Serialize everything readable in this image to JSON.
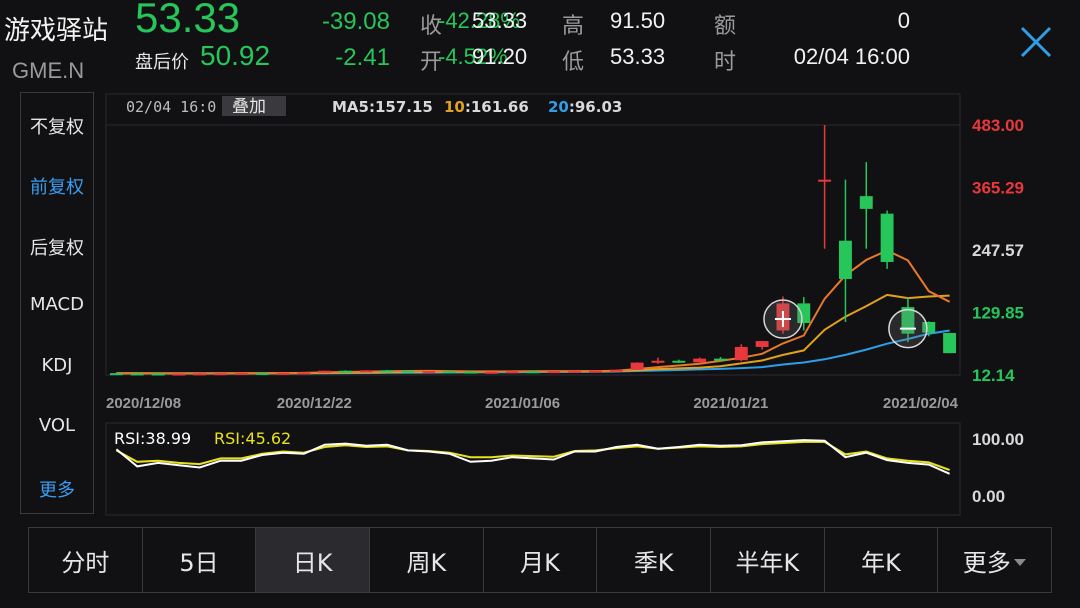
{
  "stock": {
    "name": "游戏驿站",
    "code": "GME.N",
    "price": "53.33",
    "change": "-39.08",
    "after_hours_label": "盘后价",
    "after_hours_price": "50.92",
    "after_hours_change": "-2.41",
    "change_pct_ghost": "-42.28%",
    "after_pct_ghost": "-4.52%"
  },
  "quote": {
    "close_label": "收",
    "close_value": "53.33",
    "high_label": "高",
    "high_value": "91.50",
    "amount_label": "额",
    "amount_value": "0",
    "open_label": "开",
    "open_value": "91.20",
    "low_label": "低",
    "low_value": "53.33",
    "time_label": "时",
    "time_value": "02/04 16:00"
  },
  "left_menu": [
    {
      "label": "不复权",
      "active": false
    },
    {
      "label": "前复权",
      "active": true
    },
    {
      "label": "后复权",
      "active": false
    },
    {
      "label": "MACD",
      "active": false
    },
    {
      "label": "KDJ",
      "active": false
    },
    {
      "label": "VOL",
      "active": false
    },
    {
      "label": "更多",
      "active": true
    }
  ],
  "tabs": [
    {
      "label": "分时",
      "active": false
    },
    {
      "label": "5日",
      "active": false
    },
    {
      "label": "日K",
      "active": true
    },
    {
      "label": "周K",
      "active": false
    },
    {
      "label": "月K",
      "active": false
    },
    {
      "label": "季K",
      "active": false
    },
    {
      "label": "半年K",
      "active": false
    },
    {
      "label": "年K",
      "active": false
    },
    {
      "label": "更多",
      "active": false,
      "dropdown": true
    }
  ],
  "colors": {
    "up": "#e8383d",
    "down": "#26c65a",
    "ma5": "#e8792a",
    "ma10": "#e0a21e",
    "ma20": "#2f9ee8",
    "rsi1": "#ffffff",
    "rsi2": "#e8e21e",
    "accent": "#3a9df2"
  },
  "chart_data": {
    "type": "candlestick",
    "date_label": "02/04 16:0",
    "overlay_button": "叠加",
    "ma_legend": [
      {
        "key": "MA5",
        "value": ":157.15",
        "color": "#e8792a"
      },
      {
        "key": "10",
        "value": ":161.66",
        "color": "#e0a21e"
      },
      {
        "key": "20",
        "value": ":96.03",
        "color": "#2f9ee8"
      }
    ],
    "y_ticks": [
      {
        "value": 483.0,
        "label": "483.00",
        "color": "#e8383d"
      },
      {
        "value": 365.29,
        "label": "365.29",
        "color": "#e8383d"
      },
      {
        "value": 247.57,
        "label": "247.57",
        "color": "#d8d8d8"
      },
      {
        "value": 129.85,
        "label": "129.85",
        "color": "#26c65a"
      },
      {
        "value": 12.14,
        "label": "12.14",
        "color": "#26c65a"
      }
    ],
    "ylim": [
      12.14,
      483.0
    ],
    "x_ticks": [
      {
        "index": 0,
        "label": "2020/12/08"
      },
      {
        "index": 10,
        "label": "2020/12/22"
      },
      {
        "index": 20,
        "label": "2021/01/06"
      },
      {
        "index": 30,
        "label": "2021/01/21"
      },
      {
        "index": 39,
        "label": "2021/02/04"
      }
    ],
    "candles": [
      {
        "o": 15.6,
        "h": 16.2,
        "l": 14.9,
        "c": 15.1
      },
      {
        "o": 15.1,
        "h": 15.6,
        "l": 14.6,
        "c": 15.0
      },
      {
        "o": 15.0,
        "h": 15.4,
        "l": 14.5,
        "c": 14.8
      },
      {
        "o": 14.8,
        "h": 15.2,
        "l": 14.3,
        "c": 14.9
      },
      {
        "o": 14.9,
        "h": 15.5,
        "l": 14.6,
        "c": 15.2
      },
      {
        "o": 15.2,
        "h": 15.9,
        "l": 14.9,
        "c": 15.5
      },
      {
        "o": 15.5,
        "h": 16.4,
        "l": 15.2,
        "c": 16.0
      },
      {
        "o": 16.0,
        "h": 16.8,
        "l": 15.6,
        "c": 15.8
      },
      {
        "o": 15.8,
        "h": 16.5,
        "l": 15.4,
        "c": 16.2
      },
      {
        "o": 16.2,
        "h": 17.2,
        "l": 16.0,
        "c": 17.0
      },
      {
        "o": 17.0,
        "h": 20.5,
        "l": 16.8,
        "c": 20.2
      },
      {
        "o": 20.2,
        "h": 21.0,
        "l": 19.5,
        "c": 19.8
      },
      {
        "o": 19.8,
        "h": 21.5,
        "l": 19.2,
        "c": 20.9
      },
      {
        "o": 20.9,
        "h": 21.8,
        "l": 19.8,
        "c": 20.2
      },
      {
        "o": 20.2,
        "h": 20.8,
        "l": 18.5,
        "c": 18.9
      },
      {
        "o": 18.9,
        "h": 19.6,
        "l": 18.2,
        "c": 19.3
      },
      {
        "o": 19.3,
        "h": 19.9,
        "l": 18.4,
        "c": 18.6
      },
      {
        "o": 18.6,
        "h": 19.0,
        "l": 17.2,
        "c": 17.4
      },
      {
        "o": 17.4,
        "h": 18.5,
        "l": 17.0,
        "c": 18.1
      },
      {
        "o": 18.1,
        "h": 19.6,
        "l": 17.9,
        "c": 19.2
      },
      {
        "o": 19.2,
        "h": 19.9,
        "l": 18.6,
        "c": 19.0
      },
      {
        "o": 19.0,
        "h": 19.8,
        "l": 18.5,
        "c": 19.4
      },
      {
        "o": 19.4,
        "h": 20.3,
        "l": 19.0,
        "c": 19.9
      },
      {
        "o": 19.9,
        "h": 21.0,
        "l": 19.4,
        "c": 20.5
      },
      {
        "o": 20.5,
        "h": 22.5,
        "l": 20.1,
        "c": 22.0
      },
      {
        "o": 22.0,
        "h": 36.0,
        "l": 21.5,
        "c": 35.5
      },
      {
        "o": 35.5,
        "h": 45.0,
        "l": 33.0,
        "c": 39.0
      },
      {
        "o": 39.0,
        "h": 41.0,
        "l": 35.0,
        "c": 36.0
      },
      {
        "o": 36.0,
        "h": 45.0,
        "l": 35.5,
        "c": 43.0
      },
      {
        "o": 43.0,
        "h": 46.0,
        "l": 39.0,
        "c": 40.0
      },
      {
        "o": 40.0,
        "h": 70.0,
        "l": 38.0,
        "c": 65.0
      },
      {
        "o": 65.0,
        "h": 76.0,
        "l": 60.0,
        "c": 76.0
      },
      {
        "o": 96.0,
        "h": 160.0,
        "l": 90.0,
        "c": 147.0
      },
      {
        "o": 147.0,
        "h": 159.0,
        "l": 96.0,
        "c": 110.0
      },
      {
        "o": 380.0,
        "h": 483.0,
        "l": 250.0,
        "c": 380.0
      },
      {
        "o": 265.0,
        "h": 380.0,
        "l": 112.0,
        "c": 193.0
      },
      {
        "o": 349.0,
        "h": 413.0,
        "l": 250.0,
        "c": 325.0
      },
      {
        "o": 316.0,
        "h": 322.0,
        "l": 212.0,
        "c": 225.0
      },
      {
        "o": 140.0,
        "h": 158.0,
        "l": 74.0,
        "c": 90.0
      },
      {
        "o": 112.0,
        "h": 113.0,
        "l": 85.0,
        "c": 92.0
      },
      {
        "o": 91.2,
        "h": 91.5,
        "l": 53.33,
        "c": 53.33
      }
    ],
    "ma5": [
      15.3,
      15.2,
      15.1,
      15.0,
      15.0,
      15.1,
      15.3,
      15.5,
      15.7,
      16.1,
      17.0,
      17.8,
      18.5,
      19.2,
      19.6,
      19.8,
      19.5,
      19.0,
      18.9,
      18.8,
      18.8,
      18.9,
      19.1,
      19.4,
      20.0,
      23.4,
      27.0,
      30.0,
      33.5,
      38.7,
      44.6,
      52.0,
      71.6,
      86.6,
      155.6,
      200.0,
      229.0,
      246.6,
      228.0,
      170.0,
      150.0
    ],
    "ma10": [
      15.4,
      15.3,
      15.2,
      15.2,
      15.1,
      15.1,
      15.2,
      15.3,
      15.4,
      15.5,
      16.1,
      16.5,
      16.9,
      17.3,
      17.7,
      18.0,
      18.2,
      18.4,
      18.6,
      18.9,
      19.1,
      19.2,
      19.2,
      19.3,
      19.4,
      21.2,
      23.2,
      24.6,
      26.1,
      28.8,
      34.0,
      39.5,
      50.0,
      58.5,
      97.2,
      122.0,
      142.0,
      163.0,
      157.0,
      160.0,
      161.66
    ],
    "ma20": [
      15.6,
      15.5,
      15.4,
      15.4,
      15.3,
      15.3,
      15.3,
      15.3,
      15.3,
      15.4,
      15.6,
      15.8,
      16.0,
      16.2,
      16.4,
      16.6,
      16.8,
      17.0,
      17.2,
      17.4,
      17.6,
      17.8,
      18.0,
      18.4,
      18.8,
      19.6,
      20.6,
      21.6,
      22.6,
      23.7,
      25.1,
      27.0,
      32.0,
      35.7,
      41.8,
      50.0,
      60.0,
      71.0,
      80.0,
      90.0,
      96.03
    ],
    "rsi": {
      "label1": "RSI:38.99",
      "label2": "RSI:45.62",
      "y_ticks": [
        {
          "value": 100,
          "label": "100.00"
        },
        {
          "value": 0,
          "label": "0.00"
        }
      ],
      "rsi1": [
        82,
        52,
        58,
        54,
        50,
        62,
        62,
        72,
        76,
        74,
        90,
        92,
        88,
        90,
        80,
        78,
        74,
        60,
        62,
        68,
        66,
        64,
        78,
        78,
        86,
        90,
        83,
        86,
        90,
        88,
        89,
        94,
        96,
        98,
        97,
        68,
        76,
        63,
        58,
        55,
        38.99
      ],
      "rsi2": [
        80,
        60,
        62,
        58,
        56,
        66,
        66,
        74,
        78,
        76,
        86,
        89,
        86,
        87,
        80,
        79,
        76,
        68,
        68,
        71,
        70,
        69,
        79,
        80,
        84,
        87,
        83,
        85,
        87,
        86,
        87,
        91,
        93,
        95,
        95,
        73,
        78,
        66,
        62,
        59,
        45.62
      ]
    }
  }
}
